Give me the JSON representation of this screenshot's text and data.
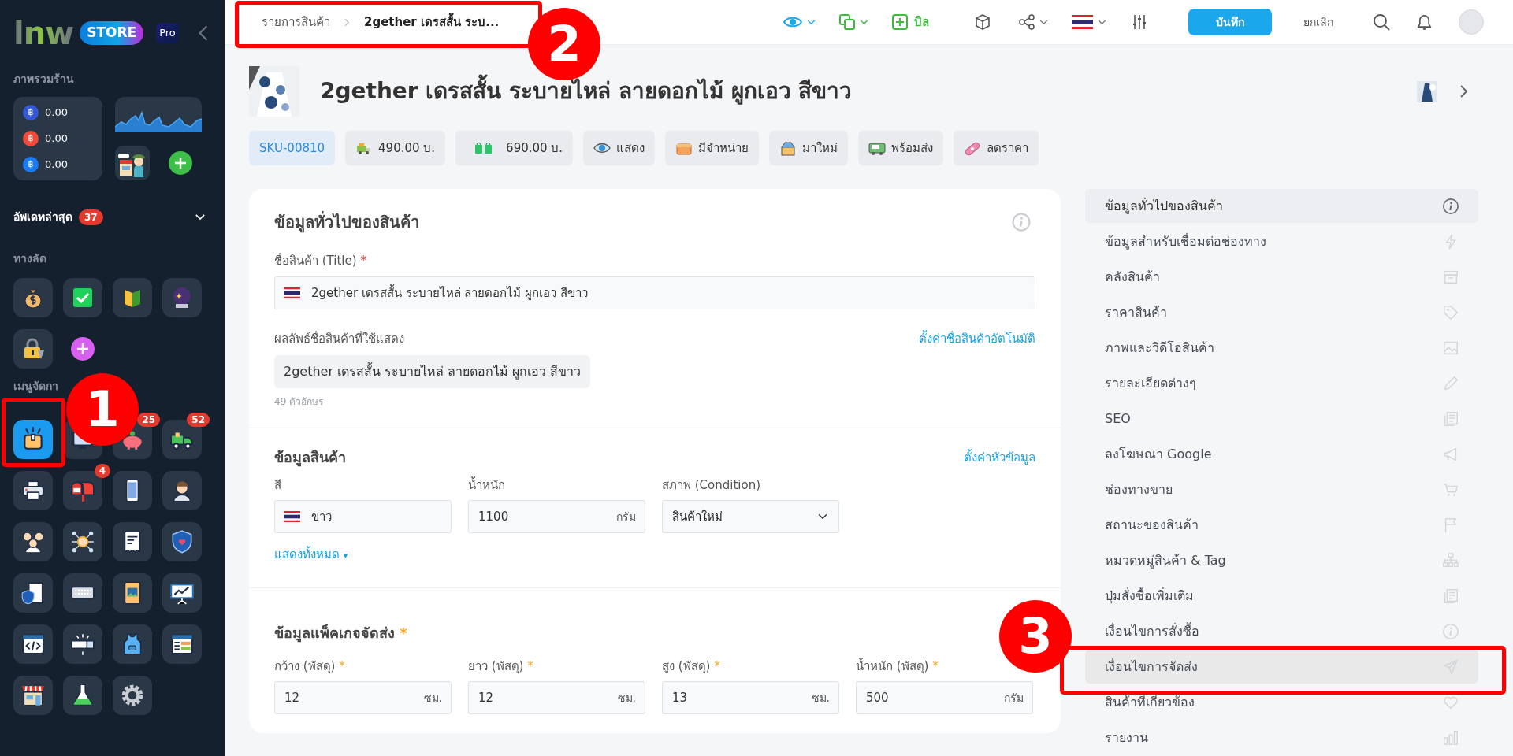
{
  "logo": {
    "word": "lnw",
    "tag": "STORE",
    "plan": "Pro"
  },
  "sidebar": {
    "overview_heading": "ภาพรวมร้าน",
    "balances": [
      {
        "symbol": "฿",
        "color": "#3558d6",
        "amount": "0.00"
      },
      {
        "symbol": "฿",
        "color": "#f04a3a",
        "amount": "0.00"
      },
      {
        "symbol": "฿",
        "color": "#1a7cf5",
        "amount": "0.00"
      }
    ],
    "updates": {
      "label": "อัพเดทล่าสุด",
      "count": "37",
      "expanded": false
    },
    "shortcuts_heading": "ทางลัด",
    "shortcuts": [
      {
        "kind": "money-bag"
      },
      {
        "kind": "checkbox"
      },
      {
        "kind": "beginner-mark"
      },
      {
        "kind": "crystal-ball"
      },
      {
        "kind": "lock"
      }
    ],
    "menu_heading": "เมนูจัดกา",
    "menu_tiles": [
      {
        "kind": "box",
        "selected": true
      },
      {
        "kind": "screen",
        "selected": false
      },
      {
        "kind": "piggy-bank",
        "selected": false,
        "badge": "25"
      },
      {
        "kind": "truck",
        "selected": false,
        "badge": "52"
      },
      {
        "kind": "printer",
        "selected": false
      },
      {
        "kind": "mailbox",
        "selected": false,
        "badge": "4"
      },
      {
        "kind": "smartphone",
        "selected": false
      },
      {
        "kind": "person",
        "selected": false
      },
      {
        "kind": "people",
        "selected": false
      },
      {
        "kind": "network",
        "selected": false
      },
      {
        "kind": "receipt",
        "selected": false
      },
      {
        "kind": "shield",
        "selected": false
      },
      {
        "kind": "shield-receipt",
        "selected": false
      },
      {
        "kind": "keyboard",
        "selected": false
      },
      {
        "kind": "picture-book",
        "selected": false
      },
      {
        "kind": "chart-board",
        "selected": false
      },
      {
        "kind": "code-window",
        "selected": false
      },
      {
        "kind": "search-bar",
        "selected": false
      },
      {
        "kind": "apron",
        "selected": false
      },
      {
        "kind": "browser-table",
        "selected": false
      },
      {
        "kind": "shop",
        "selected": false
      },
      {
        "kind": "flask",
        "selected": false
      },
      {
        "kind": "gear",
        "selected": false
      }
    ]
  },
  "topbar": {
    "breadcrumb": [
      {
        "label": "รายการสินค้า",
        "current": false
      },
      {
        "label": "2gether เดรสสั้น ระบ...",
        "current": true
      }
    ],
    "bill_label": "บิล",
    "save": "บันทึก",
    "cancel": "ยกเลิก"
  },
  "product": {
    "title": "2gether เดรสสั้น ระบายไหล่ ลายดอกไม้ ผูกเอว สีขาว",
    "badges": [
      {
        "kind": "sku",
        "label": "SKU-00810"
      },
      {
        "kind": "price",
        "label": "490.00 บ."
      },
      {
        "kind": "sale-price",
        "label": "690.00 บ."
      },
      {
        "kind": "visible",
        "label": "แสดง"
      },
      {
        "kind": "in-stock",
        "label": "มีจำหน่าย"
      },
      {
        "kind": "new",
        "label": "มาใหม่"
      },
      {
        "kind": "ready",
        "label": "พร้อมส่ง"
      },
      {
        "kind": "discount",
        "label": "ลดราคา"
      }
    ]
  },
  "general": {
    "heading": "ข้อมูลทั่วไปของสินค้า",
    "title_label": "ชื่อสินค้า (Title)",
    "required_mark": "*",
    "title_value": "2gether เดรสสั้น ระบายไหล่ ลายดอกไม้ ผูกเอว สีขาว",
    "display_label": "ผลลัพธ์ชื่อสินค้าที่ใช้แสดง",
    "auto_link": "ตั้งค่าชื่อสินค้าอัตโนมัติ",
    "display_value": "2gether เดรสสั้น ระบายไหล่ ลายดอกไม้ ผูกเอว สีขาว",
    "char_count": "49 ตัวอักษร"
  },
  "product_info": {
    "heading": "ข้อมูลสินค้า",
    "settings_link": "ตั้งค่าหัวข้อมูล",
    "fields": [
      {
        "kind": "flag-text",
        "label": "สี",
        "value": "ขาว"
      },
      {
        "kind": "unit",
        "label": "น้ำหนัก",
        "value": "1100",
        "unit": "กรัม"
      },
      {
        "kind": "select",
        "label": "สภาพ (Condition)",
        "value": "สินค้าใหม่"
      }
    ],
    "show_all": "แสดงทั้งหมด",
    "show_all_caret": "▾"
  },
  "package": {
    "heading": "ข้อมูลแพ็คเกจจัดส่ง",
    "required_mark": "*",
    "fields": [
      {
        "label": "กว้าง (พัสดุ)",
        "required": true,
        "value": "12",
        "unit": "ซม."
      },
      {
        "label": "ยาว (พัสดุ)",
        "required": true,
        "value": "12",
        "unit": "ซม."
      },
      {
        "label": "สูง (พัสดุ)",
        "required": true,
        "value": "13",
        "unit": "ซม."
      },
      {
        "label": "น้ำหนัก (พัสดุ)",
        "required": true,
        "value": "500",
        "unit": "กรัม"
      }
    ]
  },
  "section_menu": [
    {
      "label": "ข้อมูลทั่วไปของสินค้า",
      "selected": true,
      "highlighted": false
    },
    {
      "label": "ข้อมูลสำหรับเชื่อมต่อช่องทาง",
      "selected": false,
      "highlighted": false
    },
    {
      "label": "คลังสินค้า",
      "selected": false,
      "highlighted": false
    },
    {
      "label": "ราคาสินค้า",
      "selected": false,
      "highlighted": false
    },
    {
      "label": "ภาพและวิดีโอสินค้า",
      "selected": false,
      "highlighted": false
    },
    {
      "label": "รายละเอียดต่างๆ",
      "selected": false,
      "highlighted": false
    },
    {
      "label": "SEO",
      "selected": false,
      "highlighted": false
    },
    {
      "label": "ลงโฆษณา Google",
      "selected": false,
      "highlighted": false
    },
    {
      "label": "ช่องทางขาย",
      "selected": false,
      "highlighted": false
    },
    {
      "label": "สถานะของสินค้า",
      "selected": false,
      "highlighted": false
    },
    {
      "label": "หมวดหมู่สินค้า & Tag",
      "selected": false,
      "highlighted": false
    },
    {
      "label": "ปุ่มสั่งซื้อเพิ่มเติม",
      "selected": false,
      "highlighted": false
    },
    {
      "label": "เงื่อนไขการสั่งซื้อ",
      "selected": false,
      "highlighted": false
    },
    {
      "label": "เงื่อนไขการจัดส่ง",
      "selected": false,
      "highlighted": true
    },
    {
      "label": "สินค้าที่เกี่ยวข้อง",
      "selected": false,
      "highlighted": false
    },
    {
      "label": "รายงาน",
      "selected": false,
      "highlighted": false
    }
  ],
  "annotations": [
    {
      "label": "1"
    },
    {
      "label": "2"
    },
    {
      "label": "3"
    }
  ]
}
